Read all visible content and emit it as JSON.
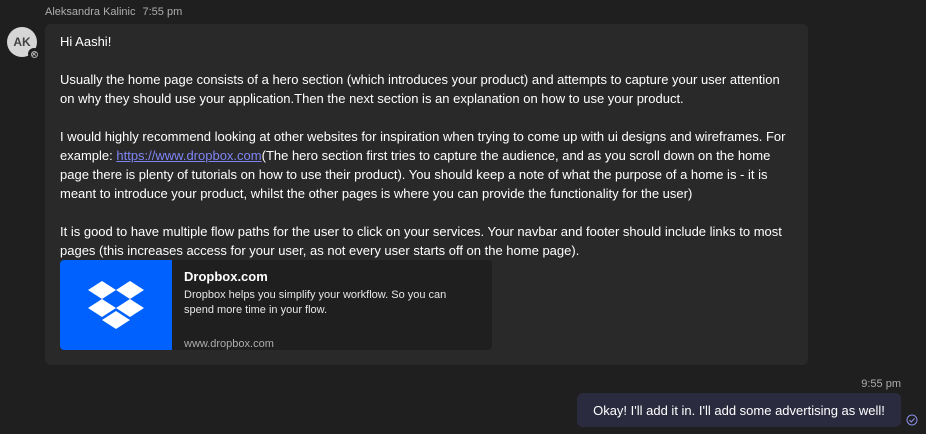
{
  "incoming": {
    "sender_name": "Aleksandra Kalinic",
    "timestamp": "7:55 pm",
    "avatar_initials": "AK",
    "greeting": "Hi Aashi!",
    "paragraph_1": "Usually the home page consists of a hero section (which introduces your product) and attempts to capture your user attention on why they should use your application.Then the next section is an explanation on how to use your product.",
    "paragraph_2_before_link": "I would highly recommend looking at other websites for inspiration when trying to come up with ui designs and wireframes. For example: ",
    "paragraph_2_link": "https://www.dropbox.com",
    "paragraph_2_after_link": "(The hero section first tries to capture the audience, and as you scroll down on the home page there is plenty of tutorials on how to use their product). You should keep a note of what the purpose of a  home is - it is meant to introduce your product, whilst the other pages is where you can provide the functionality for the user)",
    "paragraph_3": "It is good to have multiple flow paths for the user to click on your services. Your navbar and footer should include links to most pages (this increases access for your user, as not every user starts off on the home page).",
    "link_preview": {
      "title": "Dropbox.com",
      "description": "Dropbox helps you simplify your workflow. So you can spend more time in your flow.",
      "domain": "www.dropbox.com",
      "logo_icon": "dropbox-logo-icon",
      "brand_color": "#0061fe"
    }
  },
  "outgoing": {
    "timestamp": "9:55 pm",
    "text": "Okay! I'll add it in. I'll add some advertising as well!",
    "status_icon": "seen-check-icon"
  },
  "colors": {
    "background": "#1f1f1f",
    "incoming_bubble": "#292929",
    "outgoing_bubble": "#2b2b40",
    "link": "#7f85f5"
  }
}
